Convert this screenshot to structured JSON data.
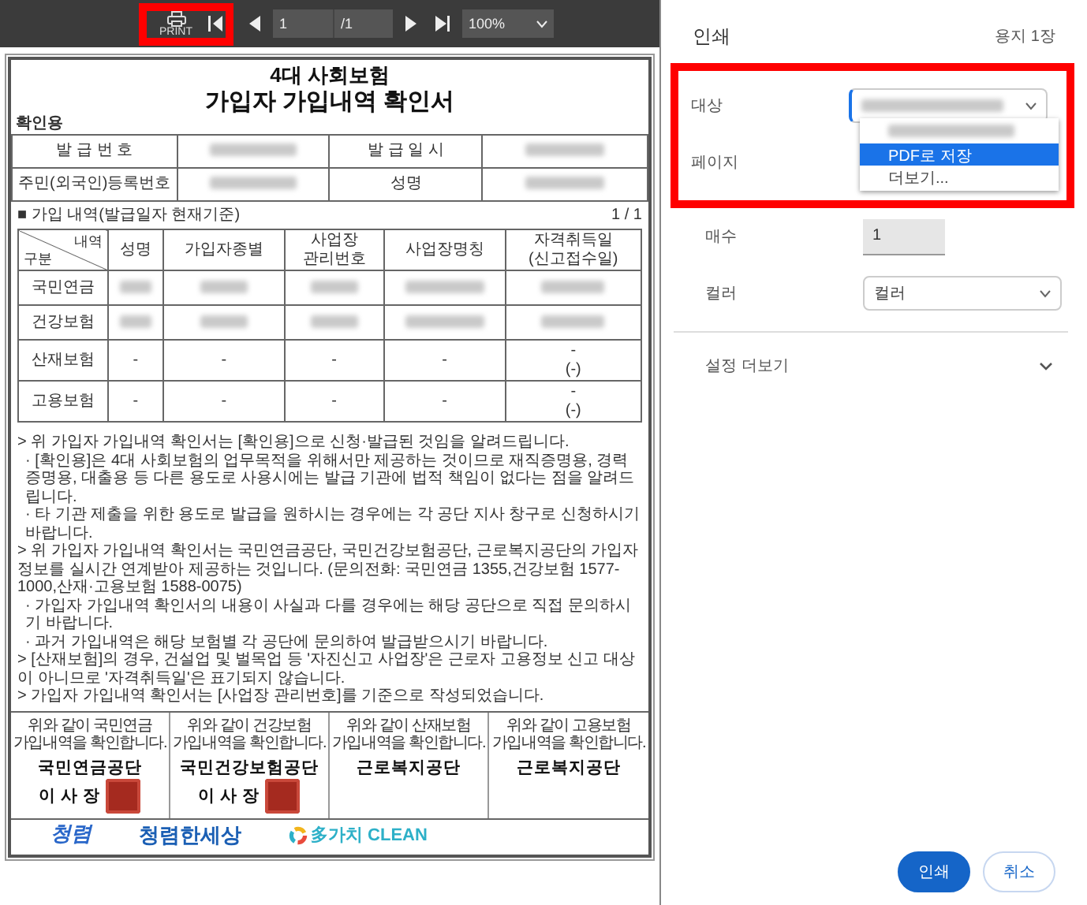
{
  "viewer_toolbar": {
    "print_button": {
      "label": "PRINT",
      "highlighted": true
    },
    "page_input": {
      "value": "1"
    },
    "page_total": "/1",
    "zoom": {
      "value": "100%"
    }
  },
  "document": {
    "title_lines": [
      "4대 사회보험",
      "가입자 가입내역 확인서"
    ],
    "purpose_label": "확인용",
    "info_rows": [
      [
        {
          "kind": "label",
          "text": "발 급 번 호"
        },
        {
          "kind": "redacted"
        },
        {
          "kind": "label",
          "text": "발 급 일 시"
        },
        {
          "kind": "redacted"
        }
      ],
      [
        {
          "kind": "label",
          "text": "주민(외국인)등록번호"
        },
        {
          "kind": "redacted"
        },
        {
          "kind": "label",
          "text": "성명"
        },
        {
          "kind": "redacted"
        }
      ]
    ],
    "section_title": "■ 가입 내역(발급일자 현재기준)",
    "page_count": "1 / 1",
    "table": {
      "corner": {
        "top": "내역",
        "bottom": "구분"
      },
      "columns": [
        {
          "lines": [
            "성명"
          ]
        },
        {
          "lines": [
            "가입자종별"
          ]
        },
        {
          "lines": [
            "사업장",
            "관리번호"
          ]
        },
        {
          "lines": [
            "사업장명칭"
          ]
        },
        {
          "lines": [
            "자격취득일",
            "(신고접수일)"
          ]
        }
      ],
      "rows": [
        {
          "label": "국민연금",
          "cells": [
            {
              "kind": "redacted"
            },
            {
              "kind": "redacted"
            },
            {
              "kind": "redacted"
            },
            {
              "kind": "redacted"
            },
            {
              "kind": "redacted"
            }
          ]
        },
        {
          "label": "건강보험",
          "cells": [
            {
              "kind": "redacted"
            },
            {
              "kind": "redacted"
            },
            {
              "kind": "redacted"
            },
            {
              "kind": "redacted"
            },
            {
              "kind": "redacted"
            }
          ]
        },
        {
          "label": "산재보험",
          "cells": [
            {
              "kind": "text",
              "lines": [
                "-"
              ]
            },
            {
              "kind": "text",
              "lines": [
                "-"
              ]
            },
            {
              "kind": "text",
              "lines": [
                "-"
              ]
            },
            {
              "kind": "text",
              "lines": [
                "-"
              ]
            },
            {
              "kind": "text",
              "lines": [
                "-",
                "(-)"
              ]
            }
          ]
        },
        {
          "label": "고용보험",
          "cells": [
            {
              "kind": "text",
              "lines": [
                "-"
              ]
            },
            {
              "kind": "text",
              "lines": [
                "-"
              ]
            },
            {
              "kind": "text",
              "lines": [
                "-"
              ]
            },
            {
              "kind": "text",
              "lines": [
                "-"
              ]
            },
            {
              "kind": "text",
              "lines": [
                "-",
                "(-)"
              ]
            }
          ]
        }
      ]
    },
    "notes": [
      {
        "kind": "main",
        "text": "> 위 가입자 가입내역 확인서는 [확인용]으로 신청·발급된 것임을 알려드립니다."
      },
      {
        "kind": "sub",
        "text": "· [확인용]은 4대 사회보험의 업무목적을 위해서만 제공하는 것이므로 재직증명용, 경력증명용, 대출용 등 다른 용도로 사용시에는 발급 기관에 법적 책임이 없다는 점을 알려드립니다."
      },
      {
        "kind": "sub",
        "text": "· 타 기관 제출을 위한 용도로 발급을 원하시는 경우에는 각 공단 지사 창구로 신청하시기 바랍니다."
      },
      {
        "kind": "main",
        "text": "> 위 가입자 가입내역 확인서는 국민연금공단, 국민건강보험공단, 근로복지공단의 가입자 정보를 실시간 연계받아 제공하는 것입니다. (문의전화: 국민연금 1355,건강보험 1577-1000,산재·고용보험 1588-0075)"
      },
      {
        "kind": "sub",
        "text": "· 가입자 가입내역 확인서의 내용이 사실과 다를 경우에는 해당 공단으로 직접 문의하시기 바랍니다."
      },
      {
        "kind": "sub",
        "text": "· 과거 가입내역은 해당 보험별 각 공단에 문의하여 발급받으시기 바랍니다."
      },
      {
        "kind": "main",
        "text": "> [산재보험]의 경우, 건설업 및 벌목업 등 '자진신고 사업장'은 근로자 고용정보 신고 대상이 아니므로 '자격취득일'은 표기되지 않습니다."
      },
      {
        "kind": "main",
        "text": "> 가입자 가입내역 확인서는 [사업장 관리번호]를 기준으로 작성되었습니다."
      }
    ],
    "confirmations": [
      {
        "lines": [
          "위와 같이 국민연금",
          "가입내역을 확인합니다."
        ],
        "issuer_lines": [
          "국민연금공단",
          "이 사 장"
        ],
        "stamped": true
      },
      {
        "lines": [
          "위와 같이 건강보험",
          "가입내역을 확인합니다."
        ],
        "issuer_lines": [
          "국민건강보험공단",
          "이 사 장"
        ],
        "stamped": true
      },
      {
        "lines": [
          "위와 같이 산재보험",
          "가입내역을 확인합니다."
        ],
        "issuer_lines": [
          "근로복지공단"
        ],
        "stamped": false
      },
      {
        "lines": [
          "위와 같이 고용보험",
          "가입내역을 확인합니다."
        ],
        "issuer_lines": [
          "근로복지공단"
        ],
        "stamped": false
      }
    ],
    "logos": [
      {
        "kind": "brush",
        "text": "청렴"
      },
      {
        "kind": "round",
        "text": "청렴한세상"
      },
      {
        "kind": "ring",
        "text": "多가치 CLEAN"
      }
    ]
  },
  "print_panel": {
    "title": "인쇄",
    "sheet_count": "용지 1장",
    "destination": {
      "label": "대상",
      "highlighted": true,
      "value": {
        "kind": "redacted"
      },
      "open": true,
      "options": [
        {
          "kind": "redacted",
          "selected": false
        },
        {
          "kind": "text",
          "text": "PDF로 저장",
          "selected": true
        },
        {
          "kind": "text",
          "text": "더보기...",
          "selected": false
        }
      ]
    },
    "pages": {
      "label": "페이지"
    },
    "copies": {
      "label": "매수",
      "value": "1",
      "disabled": true
    },
    "color": {
      "label": "컬러",
      "value": "컬러"
    },
    "more_settings": {
      "label": "설정 더보기",
      "expanded": false
    },
    "buttons": [
      {
        "label": "인쇄",
        "kind": "primary"
      },
      {
        "label": "취소",
        "kind": "secondary"
      }
    ]
  }
}
